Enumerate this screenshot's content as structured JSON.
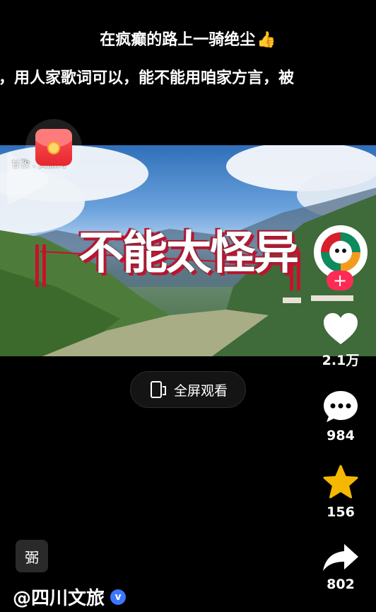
{
  "danmaku": [
    {
      "text": "在疯癫的路上一骑绝尘",
      "emoji": "👍"
    },
    {
      "text": "，用人家歌词可以，能不能用咱家方言，被"
    }
  ],
  "video": {
    "watermark": "甘孜 . 文旅网",
    "title_overlay": "不能太怪异"
  },
  "actions": {
    "fullscreen_label": "全屏观看",
    "likes": "2.1万",
    "comments": "984",
    "favorites": "156",
    "shares": "802",
    "follow_symbol": "+"
  },
  "author": {
    "name": "@四川文旅",
    "verified_symbol": "v"
  },
  "badge": {
    "text": "弻"
  },
  "colors": {
    "accent_red": "#fe2c55",
    "overlay_red": "#c8102e",
    "verified_blue": "#3b78ff",
    "star_yellow": "#f5b700"
  },
  "icons": [
    "red-envelope-icon",
    "play-icon",
    "heart-icon",
    "comment-icon",
    "star-icon",
    "share-icon",
    "fullscreen-icon",
    "verified-icon"
  ]
}
